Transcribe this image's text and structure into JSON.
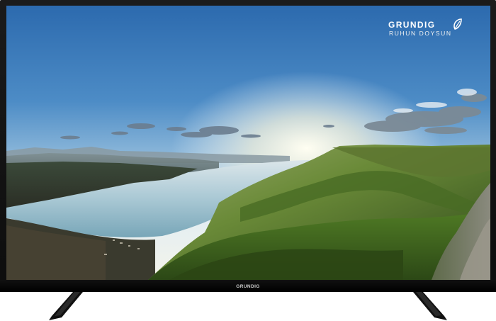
{
  "brand": {
    "name": "GRUNDIG",
    "tagline": "RUHUN DOYSUN",
    "leaf_icon": "leaf-icon"
  },
  "bezel": {
    "bottom_logo": "GRUNDIG"
  },
  "colors": {
    "bezel": "#111111",
    "sky_top": "#2f6fb0",
    "sky_horizon": "#e8eef0",
    "water": "#8fb8c8",
    "hills": "#5d7d2e"
  }
}
